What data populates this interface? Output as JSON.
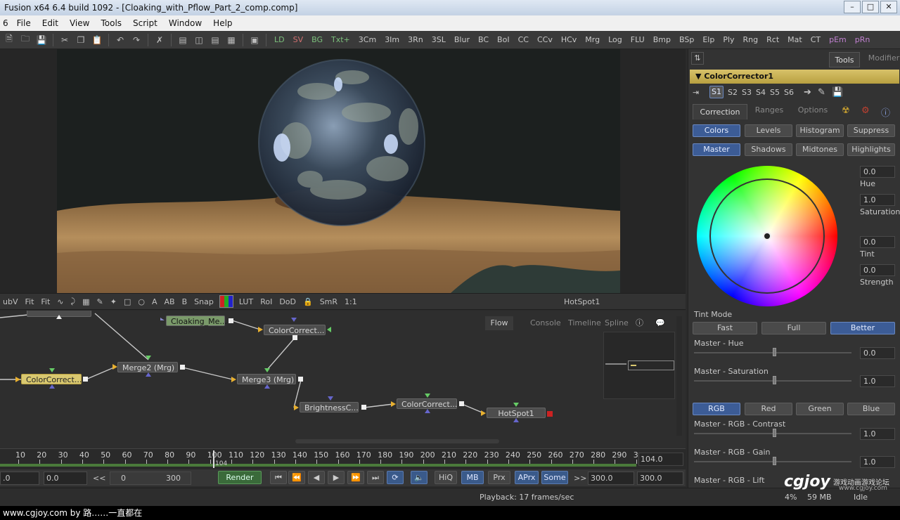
{
  "window": {
    "title": "Fusion x64 6.4 build 1092 - [Cloaking_with_Pflow_Part_2_comp.comp]"
  },
  "menu": [
    "File",
    "Edit",
    "View",
    "Tools",
    "Script",
    "Window",
    "Help"
  ],
  "toolbar": {
    "tools": [
      "LD",
      "SV",
      "BG",
      "Txt+",
      "3Cm",
      "3Im",
      "3Rn",
      "3SL",
      "Blur",
      "BC",
      "BoI",
      "CC",
      "CCv",
      "HCv",
      "Mrg",
      "Log",
      "FLU",
      "Bmp",
      "BSp",
      "Elp",
      "Ply",
      "Rng",
      "Rct",
      "Mat",
      "CT",
      "pEm",
      "pRn"
    ]
  },
  "viewer_bar": {
    "items": [
      "ubV",
      "Fit",
      "Fit",
      "Snap",
      "LUT",
      "RoI",
      "DoD",
      "SmR",
      "1:1"
    ],
    "view_name": "HotSpot1"
  },
  "flow": {
    "tabs": [
      "Flow",
      "Console",
      "Timeline",
      "Spline"
    ],
    "nodes": {
      "cloaking": "Cloaking_Me...",
      "cc_top": "ColorCorrect...",
      "cc_left": "ColorCorrect...",
      "merge2": "Merge2  (Mrg)",
      "merge3": "Merge3  (Mrg)",
      "brightness": "BrightnessC...",
      "cc_bottom": "ColorCorrect...",
      "hotspot": "HotSpot1"
    }
  },
  "timeline": {
    "ticks": [
      "10",
      "20",
      "30",
      "40",
      "50",
      "60",
      "70",
      "80",
      "90",
      "100",
      "110",
      "120",
      "130",
      "140",
      "150",
      "160",
      "170",
      "180",
      "190",
      "200",
      "210",
      "220",
      "230",
      "240",
      "250",
      "260",
      "270",
      "280",
      "290",
      "3"
    ],
    "current_frame": "104.0",
    "playhead_frame": "104"
  },
  "transport": {
    "global_start": ".0",
    "render_start": "0.0",
    "range_start": "0",
    "range_end": "300",
    "render_label": "Render",
    "buttons": [
      "HiQ",
      "MB",
      "Prx",
      "APrx",
      "Some"
    ],
    "render_end": "300.0",
    "global_end": "300.0",
    "step_back": "<<",
    "step_fwd": ">>"
  },
  "status": {
    "playback": "Playback: 17 frames/sec",
    "zoom": "4%",
    "memory": "59 MB",
    "state": "Idle"
  },
  "footer": {
    "text": "www.cgjoy.com by 路……一直都在"
  },
  "watermark": {
    "logo": "cgjoy",
    "cn": "游戏动画游戏论坛",
    "url": "www.cgjoy.com"
  },
  "panel": {
    "tabs": [
      "Tools",
      "Modifier"
    ],
    "tool_name": "ColorCorrector1",
    "slots": [
      "S1",
      "S2",
      "S3",
      "S4",
      "S5",
      "S6"
    ],
    "subtabs": [
      "Correction",
      "Ranges",
      "Options"
    ],
    "modes": [
      "Colors",
      "Levels",
      "Histogram",
      "Suppress"
    ],
    "ranges": [
      "Master",
      "Shadows",
      "Midtones",
      "Highlights"
    ],
    "wheel": {
      "hue": {
        "label": "Hue",
        "value": "0.0"
      },
      "saturation": {
        "label": "Saturation",
        "value": "1.0"
      },
      "tint": {
        "label": "Tint",
        "value": "0.0"
      },
      "strength": {
        "label": "Strength",
        "value": "0.0"
      }
    },
    "tint_mode": {
      "label": "Tint Mode",
      "options": [
        "Fast",
        "Full",
        "Better"
      ]
    },
    "master_hue": {
      "label": "Master - Hue",
      "value": "0.0"
    },
    "master_sat": {
      "label": "Master - Saturation",
      "value": "1.0"
    },
    "channels": [
      "RGB",
      "Red",
      "Green",
      "Blue"
    ],
    "contrast": {
      "label": "Master - RGB - Contrast",
      "value": "1.0"
    },
    "gain": {
      "label": "Master - RGB - Gain",
      "value": "1.0"
    },
    "lift": {
      "label": "Master - RGB - Lift"
    }
  },
  "colors": {
    "accent": "#3c5c96",
    "node_selected": "#d9c870",
    "node_loader": "#7a9a6a"
  }
}
